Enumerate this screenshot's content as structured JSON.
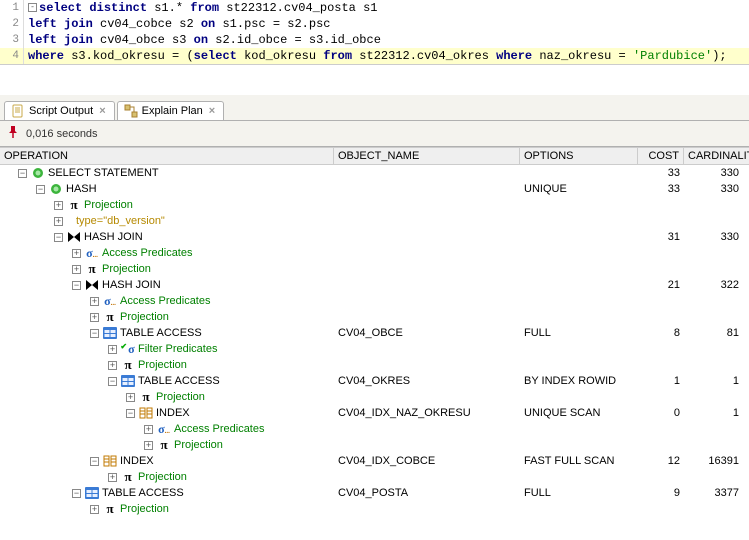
{
  "sql": {
    "lines": [
      {
        "n": "1",
        "tokens": [
          [
            "collapse",
            ""
          ],
          [
            "kw",
            "select"
          ],
          [
            "sp",
            " "
          ],
          [
            "kw",
            "distinct"
          ],
          [
            "sp",
            " "
          ],
          [
            "txt",
            "s1.* "
          ],
          [
            "kw",
            "from"
          ],
          [
            "sp",
            " "
          ],
          [
            "txt",
            "st22312.cv04_posta s1"
          ]
        ]
      },
      {
        "n": "2",
        "tokens": [
          [
            "kw",
            "left"
          ],
          [
            "sp",
            " "
          ],
          [
            "kw",
            "join"
          ],
          [
            "sp",
            " "
          ],
          [
            "txt",
            "cv04_cobce s2 "
          ],
          [
            "kw",
            "on"
          ],
          [
            "sp",
            " "
          ],
          [
            "txt",
            "s1.psc = s2.psc"
          ]
        ]
      },
      {
        "n": "3",
        "tokens": [
          [
            "kw",
            "left"
          ],
          [
            "sp",
            " "
          ],
          [
            "kw",
            "join"
          ],
          [
            "sp",
            " "
          ],
          [
            "txt",
            "cv04_obce s3 "
          ],
          [
            "kw",
            "on"
          ],
          [
            "sp",
            " "
          ],
          [
            "txt",
            "s2.id_obce = s3.id_obce"
          ]
        ]
      },
      {
        "n": "4",
        "hl": true,
        "tokens": [
          [
            "kw",
            "where"
          ],
          [
            "sp",
            " "
          ],
          [
            "txt",
            "s3.kod_okresu = ("
          ],
          [
            "kw",
            "select"
          ],
          [
            "sp",
            " "
          ],
          [
            "txt",
            "kod_okresu "
          ],
          [
            "kw",
            "from"
          ],
          [
            "sp",
            " "
          ],
          [
            "txt",
            "st22312.cv04_okres "
          ],
          [
            "kw",
            "where"
          ],
          [
            "sp",
            " "
          ],
          [
            "txt",
            "naz_okresu = "
          ],
          [
            "str",
            "'Pardubice'"
          ],
          [
            "txt",
            ");"
          ]
        ]
      }
    ]
  },
  "tabs": {
    "script_output": "Script Output",
    "explain_plan": "Explain Plan"
  },
  "toolbar": {
    "elapsed": "0,016 seconds"
  },
  "plan_headers": {
    "operation": "OPERATION",
    "object": "OBJECT_NAME",
    "options": "OPTIONS",
    "cost": "COST",
    "card": "CARDINALITY"
  },
  "plan_rows": [
    {
      "depth": 0,
      "toggle": "-",
      "icon": "disc",
      "label": "SELECT STATEMENT",
      "obj": "",
      "opt": "",
      "cost": "33",
      "card": "330"
    },
    {
      "depth": 1,
      "toggle": "-",
      "icon": "disc",
      "label": "HASH",
      "obj": "",
      "opt": "UNIQUE",
      "cost": "33",
      "card": "330"
    },
    {
      "depth": 2,
      "toggle": "+",
      "icon": "pi",
      "label": "Projection",
      "cls": "green-txt"
    },
    {
      "depth": 2,
      "toggle": "+",
      "icon": "none",
      "label": "type=\"db_version\"",
      "cls": "gold-txt"
    },
    {
      "depth": 2,
      "toggle": "-",
      "icon": "bowtie",
      "label": "HASH JOIN",
      "obj": "",
      "opt": "",
      "cost": "31",
      "card": "330"
    },
    {
      "depth": 3,
      "toggle": "+",
      "icon": "sigma",
      "label": "Access Predicates",
      "cls": "green-txt"
    },
    {
      "depth": 3,
      "toggle": "+",
      "icon": "pi",
      "label": "Projection",
      "cls": "green-txt"
    },
    {
      "depth": 3,
      "toggle": "-",
      "icon": "bowtie",
      "label": "HASH JOIN",
      "obj": "",
      "opt": "",
      "cost": "21",
      "card": "322"
    },
    {
      "depth": 4,
      "toggle": "+",
      "icon": "sigma",
      "label": "Access Predicates",
      "cls": "green-txt"
    },
    {
      "depth": 4,
      "toggle": "+",
      "icon": "pi",
      "label": "Projection",
      "cls": "green-txt"
    },
    {
      "depth": 4,
      "toggle": "-",
      "icon": "table",
      "label": "TABLE ACCESS",
      "obj": "CV04_OBCE",
      "opt": "FULL",
      "cost": "8",
      "card": "81"
    },
    {
      "depth": 5,
      "toggle": "+",
      "icon": "sigmaf",
      "label": "Filter Predicates",
      "cls": "green-txt"
    },
    {
      "depth": 5,
      "toggle": "+",
      "icon": "pi",
      "label": "Projection",
      "cls": "green-txt"
    },
    {
      "depth": 5,
      "toggle": "-",
      "icon": "table",
      "label": "TABLE ACCESS",
      "obj": "CV04_OKRES",
      "opt": "BY INDEX ROWID",
      "cost": "1",
      "card": "1"
    },
    {
      "depth": 6,
      "toggle": "+",
      "icon": "pi",
      "label": "Projection",
      "cls": "green-txt"
    },
    {
      "depth": 6,
      "toggle": "-",
      "icon": "index",
      "label": "INDEX",
      "obj": "CV04_IDX_NAZ_OKRESU",
      "opt": "UNIQUE SCAN",
      "cost": "0",
      "card": "1"
    },
    {
      "depth": 7,
      "toggle": "+",
      "icon": "sigma",
      "label": "Access Predicates",
      "cls": "green-txt"
    },
    {
      "depth": 7,
      "toggle": "+",
      "icon": "pi",
      "label": "Projection",
      "cls": "green-txt"
    },
    {
      "depth": 4,
      "toggle": "-",
      "icon": "index",
      "label": "INDEX",
      "obj": "CV04_IDX_COBCE",
      "opt": "FAST FULL SCAN",
      "cost": "12",
      "card": "16391"
    },
    {
      "depth": 5,
      "toggle": "+",
      "icon": "pi",
      "label": "Projection",
      "cls": "green-txt"
    },
    {
      "depth": 3,
      "toggle": "-",
      "icon": "table",
      "label": "TABLE ACCESS",
      "obj": "CV04_POSTA",
      "opt": "FULL",
      "cost": "9",
      "card": "3377"
    },
    {
      "depth": 4,
      "toggle": "+",
      "icon": "pi",
      "label": "Projection",
      "cls": "green-txt"
    }
  ]
}
